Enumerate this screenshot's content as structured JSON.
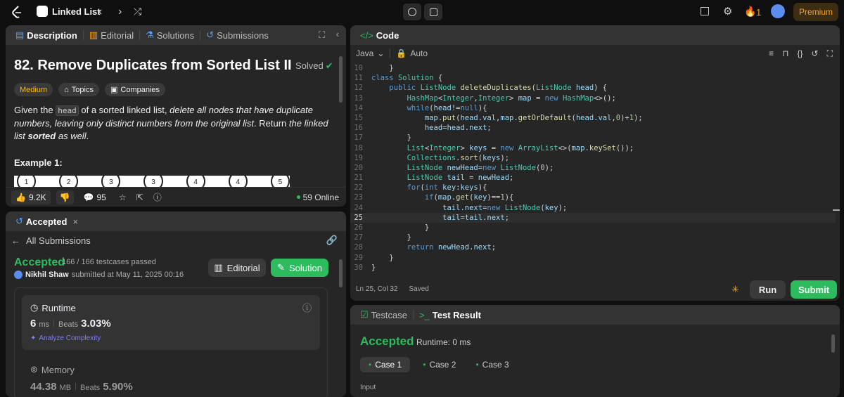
{
  "topbar": {
    "problem_list_label": "Linked List",
    "streak_count": "1",
    "premium_label": "Premium"
  },
  "left_panel": {
    "tabs": [
      "Description",
      "Editorial",
      "Solutions",
      "Submissions"
    ],
    "problem_title": "82. Remove Duplicates from Sorted List II",
    "solved_label": "Solved",
    "difficulty": "Medium",
    "topics_label": "Topics",
    "companies_label": "Companies",
    "desc_part1": "Given the ",
    "desc_code": "head",
    "desc_part2": " of a sorted linked list, ",
    "desc_italic": "delete all nodes that have duplicate numbers, leaving only distinct numbers from the original list",
    "desc_part3": ". Return ",
    "desc_italic2": "the linked list ",
    "desc_bold": "sorted",
    "desc_italic3": " as well",
    "desc_end": ".",
    "example_title": "Example 1:",
    "nodes": [
      "1",
      "2",
      "3",
      "3",
      "4",
      "4",
      "5"
    ],
    "likes": "9.2K",
    "comments": "95",
    "online": "59 Online"
  },
  "submission_panel": {
    "tab_label": "Accepted",
    "back_label": "All Submissions",
    "status": "Accepted",
    "testcases": "166 / 166 testcases passed",
    "user": "Nikhil Shaw",
    "submitted_text": "submitted at May 11, 2025 00:16",
    "editorial_btn": "Editorial",
    "solution_btn": "Solution",
    "runtime_label": "Runtime",
    "runtime_value": "6",
    "runtime_unit": "ms",
    "beats_label": "Beats",
    "runtime_beats": "3.03%",
    "analyze_label": "Analyze Complexity",
    "memory_label": "Memory",
    "memory_value": "44.38",
    "memory_unit": "MB",
    "memory_beats": "5.90%"
  },
  "code_panel": {
    "title": "Code",
    "language": "Java",
    "auto_label": "Auto",
    "status_pos": "Ln 25, Col 32",
    "status_saved": "Saved",
    "run_label": "Run",
    "submit_label": "Submit",
    "lines": [
      {
        "n": "10",
        "html": "<span class='tx'>    }</span>"
      },
      {
        "n": "11",
        "html": "<span class='kw'>class</span> <span class='ty'>Solution</span> <span class='tx'>{</span>"
      },
      {
        "n": "12",
        "html": "    <span class='kw'>public</span> <span class='ty'>ListNode</span> <span class='fn'>deleteDuplicates</span><span class='tx'>(</span><span class='ty'>ListNode</span> <span class='vr'>head</span><span class='tx'>) {</span>"
      },
      {
        "n": "13",
        "html": "        <span class='ty'>HashMap</span><span class='tx'>&lt;</span><span class='ty'>Integer</span><span class='tx'>,</span><span class='ty'>Integer</span><span class='tx'>&gt;</span> <span class='vr'>map</span> <span class='tx'>=</span> <span class='kw'>new</span> <span class='ty'>HashMap</span><span class='tx'>&lt;&gt;();</span>"
      },
      {
        "n": "14",
        "html": "        <span class='kw'>while</span><span class='tx'>(</span><span class='vr'>head</span><span class='tx'>!=</span><span class='kw'>null</span><span class='tx'>){</span>"
      },
      {
        "n": "15",
        "html": "            <span class='vr'>map</span><span class='tx'>.</span><span class='fn'>put</span><span class='tx'>(</span><span class='vr'>head</span><span class='tx'>.</span><span class='vr'>val</span><span class='tx'>,</span><span class='vr'>map</span><span class='tx'>.</span><span class='fn'>getOrDefault</span><span class='tx'>(</span><span class='vr'>head</span><span class='tx'>.</span><span class='vr'>val</span><span class='tx'>,</span><span class='nm'>0</span><span class='tx'>)+</span><span class='nm'>1</span><span class='tx'>);</span>"
      },
      {
        "n": "16",
        "html": "            <span class='vr'>head</span><span class='tx'>=</span><span class='vr'>head</span><span class='tx'>.</span><span class='vr'>next</span><span class='tx'>;</span>"
      },
      {
        "n": "17",
        "html": "        <span class='tx'>}</span>"
      },
      {
        "n": "18",
        "html": "        <span class='ty'>List</span><span class='tx'>&lt;</span><span class='ty'>Integer</span><span class='tx'>&gt;</span> <span class='vr'>keys</span> <span class='tx'>=</span> <span class='kw'>new</span> <span class='ty'>ArrayList</span><span class='tx'>&lt;&gt;(</span><span class='vr'>map</span><span class='tx'>.</span><span class='fn'>keySet</span><span class='tx'>());</span>"
      },
      {
        "n": "19",
        "html": "        <span class='ty'>Collections</span><span class='tx'>.</span><span class='fn'>sort</span><span class='tx'>(</span><span class='vr'>keys</span><span class='tx'>);</span>"
      },
      {
        "n": "20",
        "html": "        <span class='ty'>ListNode</span> <span class='vr'>newHead</span><span class='tx'>=</span><span class='kw'>new</span> <span class='ty'>ListNode</span><span class='tx'>(</span><span class='nm'>0</span><span class='tx'>);</span>"
      },
      {
        "n": "21",
        "html": "        <span class='ty'>ListNode</span> <span class='vr'>tail</span> <span class='tx'>=</span> <span class='vr'>newHead</span><span class='tx'>;</span>"
      },
      {
        "n": "22",
        "html": "        <span class='kw'>for</span><span class='tx'>(</span><span class='kw'>int</span> <span class='vr'>key</span><span class='tx'>:</span><span class='vr'>keys</span><span class='tx'>){</span>"
      },
      {
        "n": "23",
        "html": "            <span class='kw'>if</span><span class='tx'>(</span><span class='vr'>map</span><span class='tx'>.</span><span class='fn'>get</span><span class='tx'>(</span><span class='vr'>key</span><span class='tx'>)==</span><span class='nm'>1</span><span class='tx'>){</span>"
      },
      {
        "n": "24",
        "html": "                <span class='vr'>tail</span><span class='tx'>.</span><span class='vr'>next</span><span class='tx'>=</span><span class='kw'>new</span> <span class='ty'>ListNode</span><span class='tx'>(</span><span class='vr'>key</span><span class='tx'>);</span>"
      },
      {
        "n": "25",
        "html": "                <span class='vr'>tail</span><span class='tx'>=</span><span class='vr'>tail</span><span class='tx'>.</span><span class='vr'>next</span><span class='tx'>;</span>"
      },
      {
        "n": "26",
        "html": "            <span class='tx'>}</span>"
      },
      {
        "n": "27",
        "html": "        <span class='tx'>}</span>"
      },
      {
        "n": "28",
        "html": "        <span class='kw'>return</span> <span class='vr'>newHead</span><span class='tx'>.</span><span class='vr'>next</span><span class='tx'>;</span>"
      },
      {
        "n": "29",
        "html": "    <span class='tx'>}</span>"
      },
      {
        "n": "30",
        "html": "<span class='tx'>}</span>"
      }
    ]
  },
  "result_panel": {
    "testcase_tab": "Testcase",
    "result_tab": "Test Result",
    "status": "Accepted",
    "runtime": "Runtime: 0 ms",
    "cases": [
      "Case 1",
      "Case 2",
      "Case 3"
    ],
    "input_label": "Input"
  }
}
